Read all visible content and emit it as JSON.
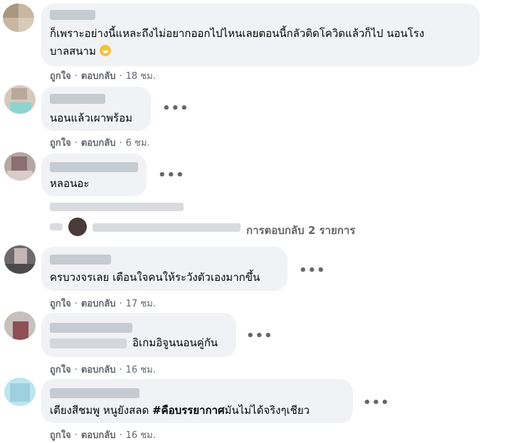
{
  "comments": [
    {
      "text_1": "ก็เพราะอย่างนี้แหละถึงไม่อยากออกไปไหนเลยตอนนี้กลัวติดโควิดแล้วก็ไป นอนโรง",
      "text_2": "บาลสนาม",
      "emoji": "grinning-face-emoji",
      "like": "ถูกใจ",
      "reply": "ตอบกลับ",
      "time": "18 ชม."
    },
    {
      "text": "นอนแล้วเผาพร้อม",
      "like": "ถูกใจ",
      "reply": "ตอบกลับ",
      "time": "6 ชม."
    },
    {
      "text": "หลอนอะ",
      "replies_label": "การตอบกลับ 2 รายการ"
    },
    {
      "text": "ครบวงจรเลย เตือนใจคนให้ระวังตัวเองมากขึ้น",
      "like": "ถูกใจ",
      "reply": "ตอบกลับ",
      "time": "17 ชม."
    },
    {
      "text": "อิเกมอิจูนนอนคู่กัน",
      "like": "ถูกใจ",
      "reply": "ตอบกลับ",
      "time": "16 ชม."
    },
    {
      "text_plain": "เตียงสีชมพู หนูยังสลด ",
      "hashtag": "#คือบรรยากาศ",
      "text_after": "มันไม่ได้จริงๆเชียว",
      "like": "ถูกใจ",
      "reply": "ตอบกลับ",
      "time": "16 ชม."
    }
  ],
  "more_icon": "more-horizontal-icon",
  "separator": "·",
  "more_dots": "•••"
}
